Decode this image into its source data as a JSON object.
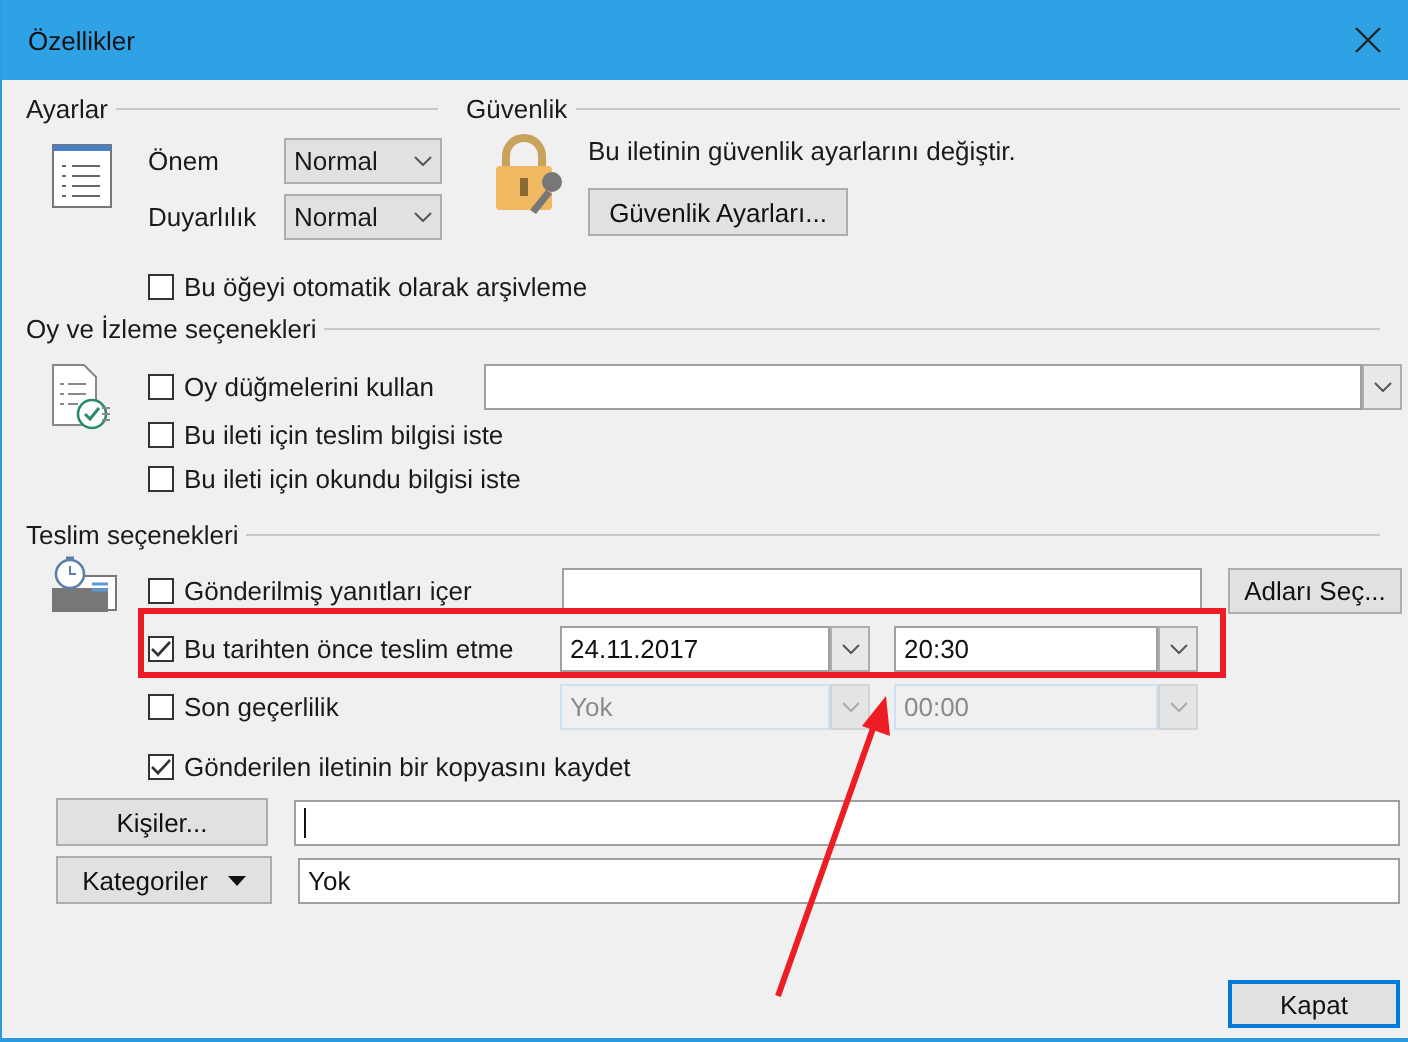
{
  "window": {
    "title": "Özellikler"
  },
  "settings": {
    "heading": "Ayarlar",
    "importance": {
      "label": "Önem",
      "value": "Normal"
    },
    "sensitivity": {
      "label": "Duyarlılık",
      "value": "Normal"
    },
    "no_autoarchive": {
      "label": "Bu öğeyi otomatik olarak arşivleme",
      "checked": false
    }
  },
  "security": {
    "heading": "Güvenlik",
    "text": "Bu iletinin güvenlik ayarlarını değiştir.",
    "button": "Güvenlik Ayarları..."
  },
  "voting": {
    "heading": "Oy ve İzleme seçenekleri",
    "options": [
      {
        "label": "Oy düğmelerini kullan",
        "checked": false
      },
      {
        "label": "Bu ileti için teslim bilgisi iste",
        "checked": false
      },
      {
        "label": "Bu ileti için okundu bilgisi iste",
        "checked": false
      }
    ]
  },
  "delivery": {
    "heading": "Teslim seçenekleri",
    "replies": {
      "label": "Gönderilmiş yanıtları içer",
      "checked": false,
      "button": "Adları Seç..."
    },
    "defer": {
      "label": "Bu tarihten önce teslim etme",
      "checked": true,
      "date": "24.11.2017",
      "time": "20:30",
      "disabled": false
    },
    "expires": {
      "label": "Son geçerlilik",
      "checked": false,
      "date": "Yok",
      "time": "00:00",
      "disabled": true
    },
    "save_copy": {
      "label": "Gönderilen iletinin bir kopyasını kaydet",
      "checked": true
    }
  },
  "contacts": {
    "button": "Kişiler..."
  },
  "categories": {
    "button": "Kategoriler",
    "value": "Yok"
  },
  "close_button": "Kapat",
  "annotations": {
    "highlight_box": true,
    "arrow": true
  }
}
